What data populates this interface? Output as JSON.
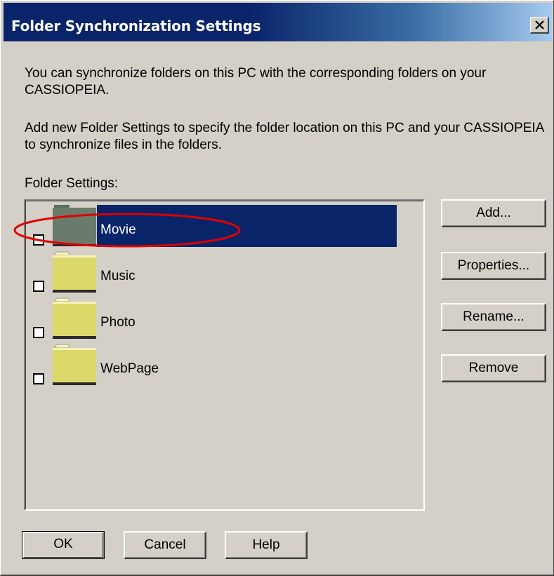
{
  "window": {
    "title": "Folder Synchronization Settings",
    "close_glyph": "close-icon"
  },
  "description": {
    "line1": "You can synchronize folders on this PC with the corresponding folders on your CASSIOPEIA.",
    "line2": "Add new Folder Settings to specify the folder location on this PC and your CASSIOPEIA to synchronize files in the folders."
  },
  "folder_settings": {
    "label": "Folder Settings:",
    "items": [
      {
        "name": "Movie",
        "selected": true,
        "checked": false,
        "icon": "folder-icon"
      },
      {
        "name": "Music",
        "selected": false,
        "checked": false,
        "icon": "folder-icon"
      },
      {
        "name": "Photo",
        "selected": false,
        "checked": false,
        "icon": "folder-icon"
      },
      {
        "name": "WebPage",
        "selected": false,
        "checked": false,
        "icon": "folder-icon"
      }
    ]
  },
  "side_buttons": {
    "add": "Add...",
    "properties": "Properties...",
    "rename": "Rename...",
    "remove": "Remove"
  },
  "bottom_buttons": {
    "ok": "OK",
    "cancel": "Cancel",
    "help": "Help"
  },
  "colors": {
    "title_bar": "#0a246a",
    "selection": "#0a246a",
    "dialog_bg": "#d4d0c8",
    "folder_yellow": "#dcd86a",
    "annotation": "#e00000"
  }
}
